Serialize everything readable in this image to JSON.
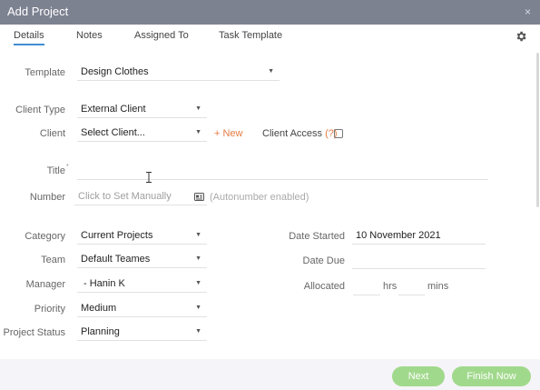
{
  "window": {
    "title": "Add Project",
    "close": "×"
  },
  "tabs": [
    {
      "label": "Details",
      "active": true
    },
    {
      "label": "Notes"
    },
    {
      "label": "Assigned To"
    },
    {
      "label": "Task Template"
    }
  ],
  "form": {
    "template": {
      "label": "Template",
      "value": "Design Clothes"
    },
    "client_type": {
      "label": "Client Type",
      "value": "External Client"
    },
    "client": {
      "label": "Client",
      "value": "Select Client..."
    },
    "new_link": "+ New",
    "client_access": {
      "label": "Client Access",
      "help": "(?)"
    },
    "title": {
      "label": "Title",
      "required_mark": "*"
    },
    "number": {
      "label": "Number",
      "placeholder": "Click to Set Manually",
      "note": "(Autonumber enabled)"
    },
    "category": {
      "label": "Category",
      "value": "Current Projects"
    },
    "team": {
      "label": "Team",
      "value": "Default Teames"
    },
    "manager": {
      "label": "Manager",
      "value": "- Hanin K"
    },
    "priority": {
      "label": "Priority",
      "value": "Medium"
    },
    "project_status": {
      "label": "Project Status",
      "value": "Planning"
    },
    "date_started": {
      "label": "Date Started",
      "value": "10 November 2021"
    },
    "date_due": {
      "label": "Date Due",
      "value": ""
    },
    "allocated": {
      "label": "Allocated",
      "hrs": "hrs",
      "mins": "mins"
    }
  },
  "buttons": {
    "next": "Next",
    "finish": "Finish Now"
  },
  "colors": {
    "titlebar": "#7d8291",
    "accent_tab": "#3f8fd0",
    "link": "#e57b42",
    "button": "#a1d98c"
  }
}
